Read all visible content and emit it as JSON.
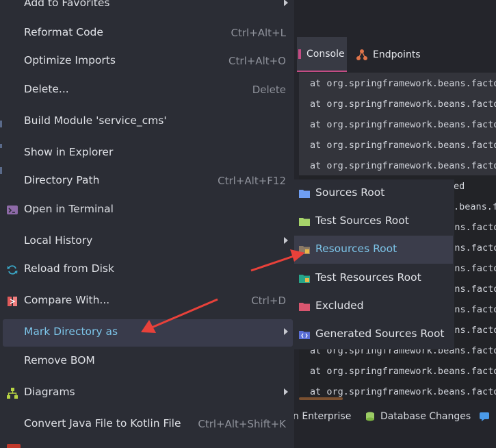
{
  "tabs": {
    "console": "Console",
    "endpoints": "Endpoints"
  },
  "console": {
    "line": "at org.springframework.beans.facto",
    "partial_1": "ed",
    "partial_2": ".beans.f"
  },
  "bottom_bar": {
    "enterprise": "n Enterprise",
    "database_changes": "Database Changes"
  },
  "menu": {
    "add_to_favorites": "Add to Favorites",
    "reformat_code": "Reformat Code",
    "reformat_code_shortcut": "Ctrl+Alt+L",
    "optimize_imports": "Optimize Imports",
    "optimize_imports_shortcut": "Ctrl+Alt+O",
    "delete": "Delete...",
    "delete_shortcut": "Delete",
    "build_module": "Build Module 'service_cms'",
    "show_in_explorer": "Show in Explorer",
    "directory_path": "Directory Path",
    "directory_path_shortcut": "Ctrl+Alt+F12",
    "open_in_terminal": "Open in Terminal",
    "local_history": "Local History",
    "reload_from_disk": "Reload from Disk",
    "compare_with": "Compare With...",
    "compare_with_shortcut": "Ctrl+D",
    "mark_directory_as": "Mark Directory as",
    "remove_bom": "Remove BOM",
    "diagrams": "Diagrams",
    "convert_java": "Convert Java File to Kotlin File",
    "convert_java_shortcut": "Ctrl+Alt+Shift+K"
  },
  "submenu": {
    "sources_root": "Sources Root",
    "test_sources_root": "Test Sources Root",
    "resources_root": "Resources Root",
    "test_resources_root": "Test Resources Root",
    "excluded": "Excluded",
    "generated_sources_root": "Generated Sources Root"
  },
  "colors": {
    "menu_bg": "#2b2d35",
    "selected_text": "#7cc4e8",
    "annotation_red": "#e8413a",
    "sources_icon": "#6f9ef2",
    "test_sources_icon": "#a6d36a",
    "resources_icon": "#8c7a66",
    "test_resources_icon": "#27a68a",
    "excluded_icon": "#d9566f",
    "generated_icon": "#5a6fd6"
  },
  "icons": {
    "console": "console-icon",
    "endpoints": "endpoints-icon",
    "terminal": "terminal-icon",
    "reload": "reload-icon",
    "compare": "compare-icon",
    "diagrams": "diagrams-icon",
    "database": "database-icon",
    "chat": "chat-icon"
  }
}
